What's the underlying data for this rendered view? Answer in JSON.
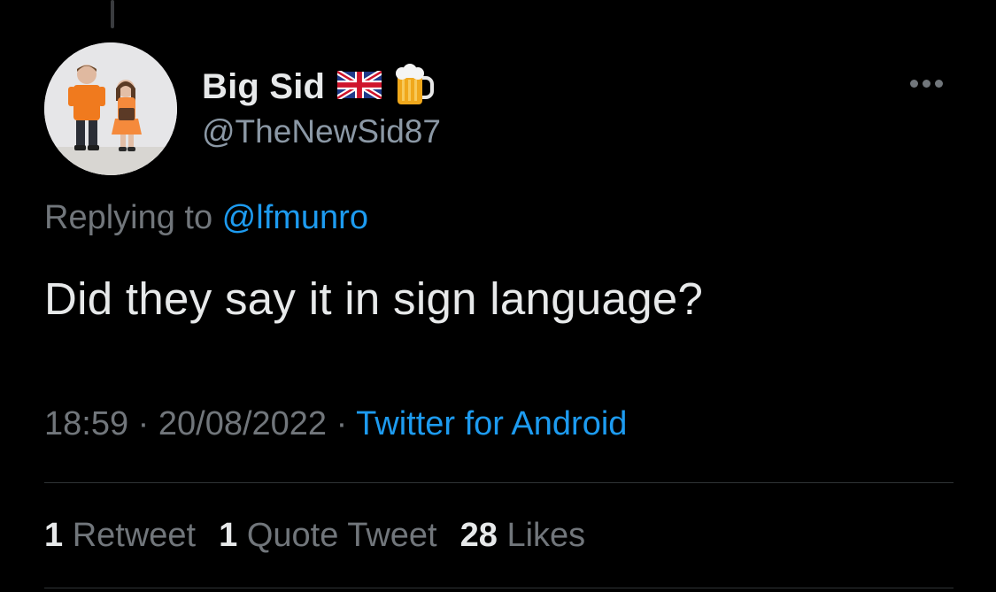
{
  "author": {
    "display_name": "Big Sid",
    "handle": "@TheNewSid87",
    "name_emojis": [
      "uk-flag-icon",
      "beer-mug-icon"
    ]
  },
  "reply": {
    "prefix": "Replying to ",
    "mention": "@lfmunro"
  },
  "tweet": {
    "text": "Did they say it in sign language?"
  },
  "meta": {
    "time": "18:59",
    "separator": " · ",
    "date": "20/08/2022",
    "source": "Twitter for Android"
  },
  "stats": {
    "retweets": {
      "count": "1",
      "label": "Retweet"
    },
    "quotes": {
      "count": "1",
      "label": "Quote Tweet"
    },
    "likes": {
      "count": "28",
      "label": "Likes"
    }
  },
  "colors": {
    "background": "#000000",
    "primary_text": "#e7e9ea",
    "secondary_text": "#71767b",
    "accent": "#1d9bf0",
    "divider": "#2f3336"
  }
}
